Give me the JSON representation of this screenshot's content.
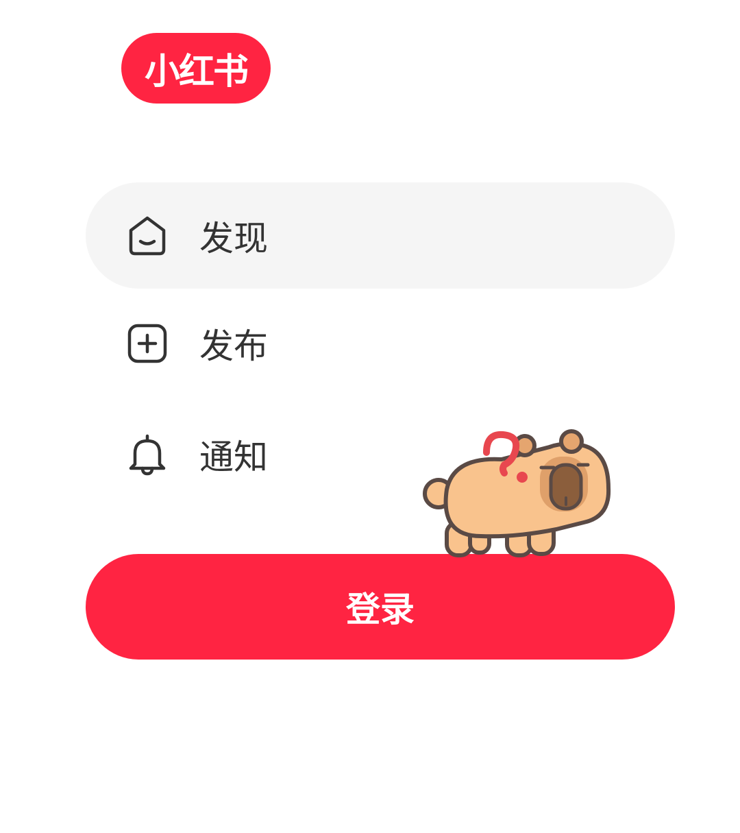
{
  "brand": {
    "logo_text": "小红书",
    "color": "#ff2442"
  },
  "nav": {
    "items": [
      {
        "label": "发现",
        "icon": "home-face-icon",
        "active": true
      },
      {
        "label": "发布",
        "icon": "plus-square-icon",
        "active": false
      },
      {
        "label": "通知",
        "icon": "bell-icon",
        "active": false
      }
    ]
  },
  "login": {
    "label": "登录"
  },
  "mascot": {
    "icon": "capybara-question-mascot"
  }
}
